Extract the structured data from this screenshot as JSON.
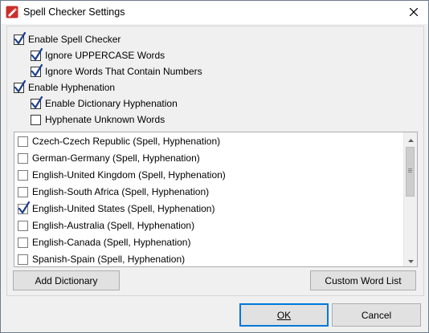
{
  "window": {
    "title": "Spell Checker Settings"
  },
  "options": {
    "enable_spell_checker": {
      "label": "Enable Spell Checker",
      "checked": true
    },
    "ignore_uppercase": {
      "label": "Ignore UPPERCASE Words",
      "checked": true
    },
    "ignore_numbers": {
      "label": "Ignore Words That Contain Numbers",
      "checked": true
    },
    "enable_hyphenation": {
      "label": "Enable Hyphenation",
      "checked": true
    },
    "enable_dictionary_hyphenation": {
      "label": "Enable Dictionary Hyphenation",
      "checked": true
    },
    "hyphenate_unknown": {
      "label": "Hyphenate Unknown Words",
      "checked": false
    }
  },
  "dictionaries": [
    {
      "label": "Czech-Czech Republic (Spell, Hyphenation)",
      "checked": false
    },
    {
      "label": "German-Germany (Spell, Hyphenation)",
      "checked": false
    },
    {
      "label": "English-United Kingdom (Spell, Hyphenation)",
      "checked": false
    },
    {
      "label": "English-South Africa (Spell, Hyphenation)",
      "checked": false
    },
    {
      "label": "English-United States (Spell, Hyphenation)",
      "checked": true
    },
    {
      "label": "English-Australia (Spell, Hyphenation)",
      "checked": false
    },
    {
      "label": "English-Canada (Spell, Hyphenation)",
      "checked": false
    },
    {
      "label": "Spanish-Spain (Spell, Hyphenation)",
      "checked": false
    }
  ],
  "buttons": {
    "add_dictionary": "Add Dictionary",
    "custom_word_list": "Custom Word List",
    "ok": "OK",
    "cancel": "Cancel"
  },
  "icons": {
    "app": "pdf-editor-icon",
    "close": "close-icon"
  },
  "colors": {
    "accent": "#0078d7",
    "app_icon": "#c9302c"
  }
}
